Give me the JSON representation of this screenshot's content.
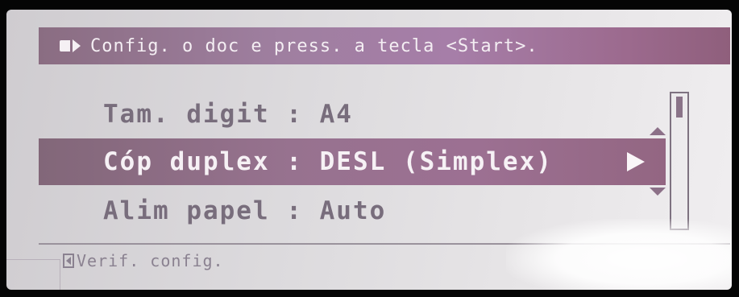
{
  "header": {
    "icon": "document-feed-icon",
    "instruction": "Config. o doc e press. a tecla <Start>."
  },
  "menu": {
    "items": [
      {
        "label": "Tam. digit : A4",
        "selected": false
      },
      {
        "label": "Cóp duplex : DESL (Simplex)",
        "selected": true
      },
      {
        "label": "Alim papel : Auto",
        "selected": false
      }
    ],
    "selected_arrow_icon": "right-arrow-icon"
  },
  "scroll": {
    "up_icon": "scroll-up-arrow-icon",
    "down_icon": "scroll-down-arrow-icon"
  },
  "footer": {
    "icon": "back-arrow-icon",
    "label": "Verif. config."
  },
  "colors": {
    "highlight_bar": "#9a7394",
    "text_dim": "#786d7c",
    "text_selected": "#f6f1f5"
  }
}
